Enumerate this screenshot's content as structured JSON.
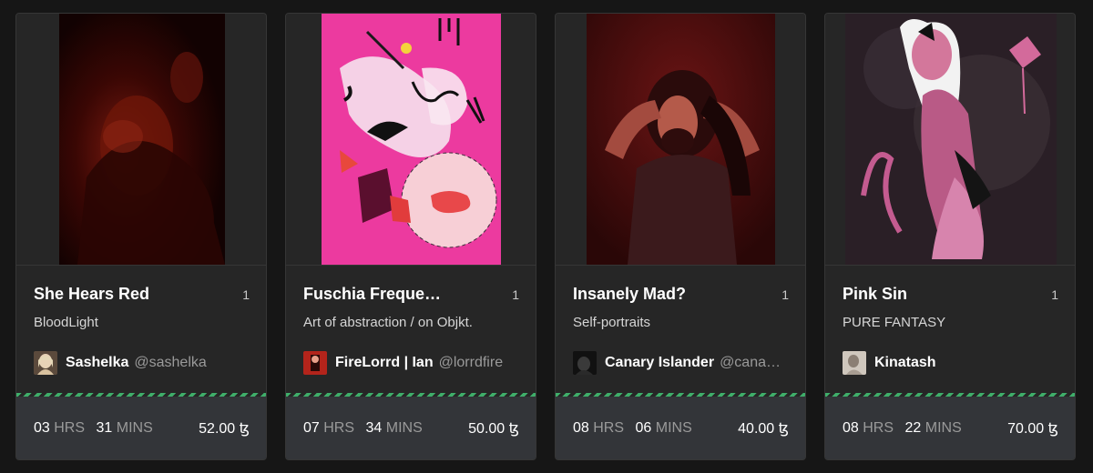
{
  "cards": [
    {
      "title": "She Hears Red",
      "edition": "1",
      "collection": "BloodLight",
      "creator_name": "Sashelka",
      "creator_handle": "@sashelka",
      "timer": {
        "hours": "03",
        "hours_unit": "HRS",
        "mins": "31",
        "mins_unit": "MINS"
      },
      "price": "52.00 ꜩ",
      "art_description_icon": "artwork-image"
    },
    {
      "title": "Fuschia Freque…",
      "edition": "1",
      "collection": "Art of abstraction / on Objkt.",
      "creator_name": "FireLorrd | Ian",
      "creator_handle": "@lorrdfire",
      "timer": {
        "hours": "07",
        "hours_unit": "HRS",
        "mins": "34",
        "mins_unit": "MINS"
      },
      "price": "50.00 ꜩ",
      "art_description_icon": "artwork-image"
    },
    {
      "title": "Insanely Mad?",
      "edition": "1",
      "collection": "Self-portraits",
      "creator_name": "Canary Islander",
      "creator_handle": "@cana…",
      "timer": {
        "hours": "08",
        "hours_unit": "HRS",
        "mins": "06",
        "mins_unit": "MINS"
      },
      "price": "40.00 ꜩ",
      "art_description_icon": "artwork-image"
    },
    {
      "title": "Pink Sin",
      "edition": "1",
      "collection": "PURE FANTASY",
      "creator_name": "Kinatash",
      "creator_handle": "",
      "timer": {
        "hours": "08",
        "hours_unit": "HRS",
        "mins": "22",
        "mins_unit": "MINS"
      },
      "price": "70.00 ꜩ",
      "art_description_icon": "artwork-image"
    }
  ],
  "colors": {
    "page_bg": "#161616",
    "card_bg": "#262626",
    "footer_bg": "#333539",
    "stripe_green": "#3fae6a"
  }
}
